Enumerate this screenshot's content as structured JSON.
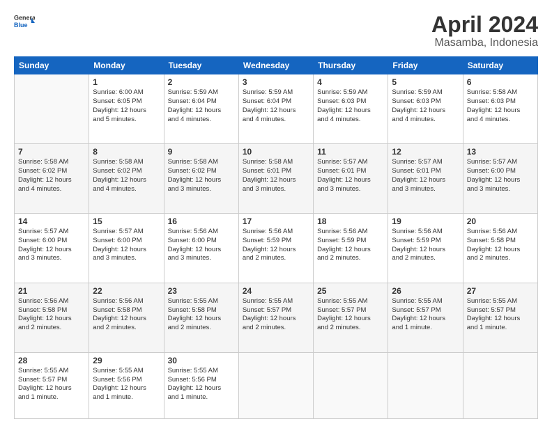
{
  "header": {
    "logo_line1": "General",
    "logo_line2": "Blue",
    "title": "April 2024",
    "subtitle": "Masamba, Indonesia"
  },
  "weekdays": [
    "Sunday",
    "Monday",
    "Tuesday",
    "Wednesday",
    "Thursday",
    "Friday",
    "Saturday"
  ],
  "weeks": [
    [
      {
        "num": "",
        "info": ""
      },
      {
        "num": "1",
        "info": "Sunrise: 6:00 AM\nSunset: 6:05 PM\nDaylight: 12 hours\nand 5 minutes."
      },
      {
        "num": "2",
        "info": "Sunrise: 5:59 AM\nSunset: 6:04 PM\nDaylight: 12 hours\nand 4 minutes."
      },
      {
        "num": "3",
        "info": "Sunrise: 5:59 AM\nSunset: 6:04 PM\nDaylight: 12 hours\nand 4 minutes."
      },
      {
        "num": "4",
        "info": "Sunrise: 5:59 AM\nSunset: 6:03 PM\nDaylight: 12 hours\nand 4 minutes."
      },
      {
        "num": "5",
        "info": "Sunrise: 5:59 AM\nSunset: 6:03 PM\nDaylight: 12 hours\nand 4 minutes."
      },
      {
        "num": "6",
        "info": "Sunrise: 5:58 AM\nSunset: 6:03 PM\nDaylight: 12 hours\nand 4 minutes."
      }
    ],
    [
      {
        "num": "7",
        "info": "Sunrise: 5:58 AM\nSunset: 6:02 PM\nDaylight: 12 hours\nand 4 minutes."
      },
      {
        "num": "8",
        "info": "Sunrise: 5:58 AM\nSunset: 6:02 PM\nDaylight: 12 hours\nand 4 minutes."
      },
      {
        "num": "9",
        "info": "Sunrise: 5:58 AM\nSunset: 6:02 PM\nDaylight: 12 hours\nand 3 minutes."
      },
      {
        "num": "10",
        "info": "Sunrise: 5:58 AM\nSunset: 6:01 PM\nDaylight: 12 hours\nand 3 minutes."
      },
      {
        "num": "11",
        "info": "Sunrise: 5:57 AM\nSunset: 6:01 PM\nDaylight: 12 hours\nand 3 minutes."
      },
      {
        "num": "12",
        "info": "Sunrise: 5:57 AM\nSunset: 6:01 PM\nDaylight: 12 hours\nand 3 minutes."
      },
      {
        "num": "13",
        "info": "Sunrise: 5:57 AM\nSunset: 6:00 PM\nDaylight: 12 hours\nand 3 minutes."
      }
    ],
    [
      {
        "num": "14",
        "info": "Sunrise: 5:57 AM\nSunset: 6:00 PM\nDaylight: 12 hours\nand 3 minutes."
      },
      {
        "num": "15",
        "info": "Sunrise: 5:57 AM\nSunset: 6:00 PM\nDaylight: 12 hours\nand 3 minutes."
      },
      {
        "num": "16",
        "info": "Sunrise: 5:56 AM\nSunset: 6:00 PM\nDaylight: 12 hours\nand 3 minutes."
      },
      {
        "num": "17",
        "info": "Sunrise: 5:56 AM\nSunset: 5:59 PM\nDaylight: 12 hours\nand 2 minutes."
      },
      {
        "num": "18",
        "info": "Sunrise: 5:56 AM\nSunset: 5:59 PM\nDaylight: 12 hours\nand 2 minutes."
      },
      {
        "num": "19",
        "info": "Sunrise: 5:56 AM\nSunset: 5:59 PM\nDaylight: 12 hours\nand 2 minutes."
      },
      {
        "num": "20",
        "info": "Sunrise: 5:56 AM\nSunset: 5:58 PM\nDaylight: 12 hours\nand 2 minutes."
      }
    ],
    [
      {
        "num": "21",
        "info": "Sunrise: 5:56 AM\nSunset: 5:58 PM\nDaylight: 12 hours\nand 2 minutes."
      },
      {
        "num": "22",
        "info": "Sunrise: 5:56 AM\nSunset: 5:58 PM\nDaylight: 12 hours\nand 2 minutes."
      },
      {
        "num": "23",
        "info": "Sunrise: 5:55 AM\nSunset: 5:58 PM\nDaylight: 12 hours\nand 2 minutes."
      },
      {
        "num": "24",
        "info": "Sunrise: 5:55 AM\nSunset: 5:57 PM\nDaylight: 12 hours\nand 2 minutes."
      },
      {
        "num": "25",
        "info": "Sunrise: 5:55 AM\nSunset: 5:57 PM\nDaylight: 12 hours\nand 2 minutes."
      },
      {
        "num": "26",
        "info": "Sunrise: 5:55 AM\nSunset: 5:57 PM\nDaylight: 12 hours\nand 1 minute."
      },
      {
        "num": "27",
        "info": "Sunrise: 5:55 AM\nSunset: 5:57 PM\nDaylight: 12 hours\nand 1 minute."
      }
    ],
    [
      {
        "num": "28",
        "info": "Sunrise: 5:55 AM\nSunset: 5:57 PM\nDaylight: 12 hours\nand 1 minute."
      },
      {
        "num": "29",
        "info": "Sunrise: 5:55 AM\nSunset: 5:56 PM\nDaylight: 12 hours\nand 1 minute."
      },
      {
        "num": "30",
        "info": "Sunrise: 5:55 AM\nSunset: 5:56 PM\nDaylight: 12 hours\nand 1 minute."
      },
      {
        "num": "",
        "info": ""
      },
      {
        "num": "",
        "info": ""
      },
      {
        "num": "",
        "info": ""
      },
      {
        "num": "",
        "info": ""
      }
    ]
  ]
}
